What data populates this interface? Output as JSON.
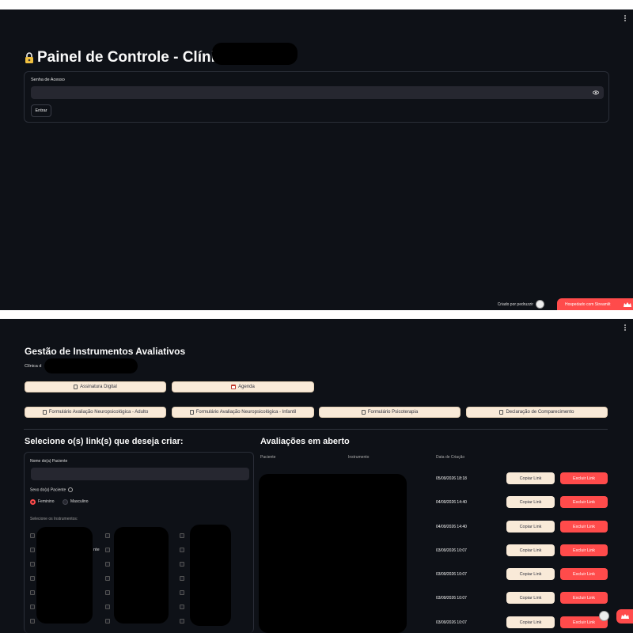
{
  "login": {
    "title": "Painel de Controle - Clínica",
    "password_label": "Senha de Acesso",
    "enter_button": "Entrar",
    "credit": "Criado por pedruzzir",
    "hosted": "Hospedado com Streamlit"
  },
  "dashboard": {
    "title": "Gestão de Instrumentos Avaliativos",
    "clinic_label": "Clínica d",
    "top_buttons": [
      "Assinatura Digital",
      "Agenda"
    ],
    "form_buttons": [
      "Formulário Avaliação Neuropsicológica - Adulto",
      "Formulário Avaliação Neuropsicológica - Infantil",
      "Formulário Psicoterapia",
      "Declaração de Comparecimento"
    ],
    "create_title": "Selecione o(s) link(s) que deseja criar:",
    "patient_name_label": "Nome do(a) Paciente",
    "sex_label": "Sexo do(a) Paciente",
    "sex_options": [
      "Feminino",
      "Masculino"
    ],
    "sex_selected": "Feminino",
    "instruments_label": "Selecione os Instrumentos:",
    "partial_instrument_text": "nte",
    "open_title": "Avaliações em aberto",
    "table_headers": [
      "Paciente",
      "Instrumento",
      "Data de Criação"
    ],
    "rows": [
      {
        "date": "05/09/2026 18:18"
      },
      {
        "date": "04/09/2026 14:40"
      },
      {
        "date": "04/09/2026 14:40"
      },
      {
        "date": "03/09/2026 10:07"
      },
      {
        "date": "03/09/2026 10:07"
      },
      {
        "date": "03/09/2026 10:07"
      },
      {
        "date": "03/09/2026 10:07"
      }
    ],
    "copy_label": "Copiar Link",
    "delete_label": "Excluir Link"
  },
  "colors": {
    "background": "#0e1117",
    "accent": "#ff4b4b",
    "cream": "#f9ead8",
    "input": "#262730"
  },
  "icons": [
    "lock-icon",
    "eye-icon",
    "document-icon",
    "calendar-icon",
    "info-icon",
    "crown-icon",
    "menu-dots-icon"
  ]
}
